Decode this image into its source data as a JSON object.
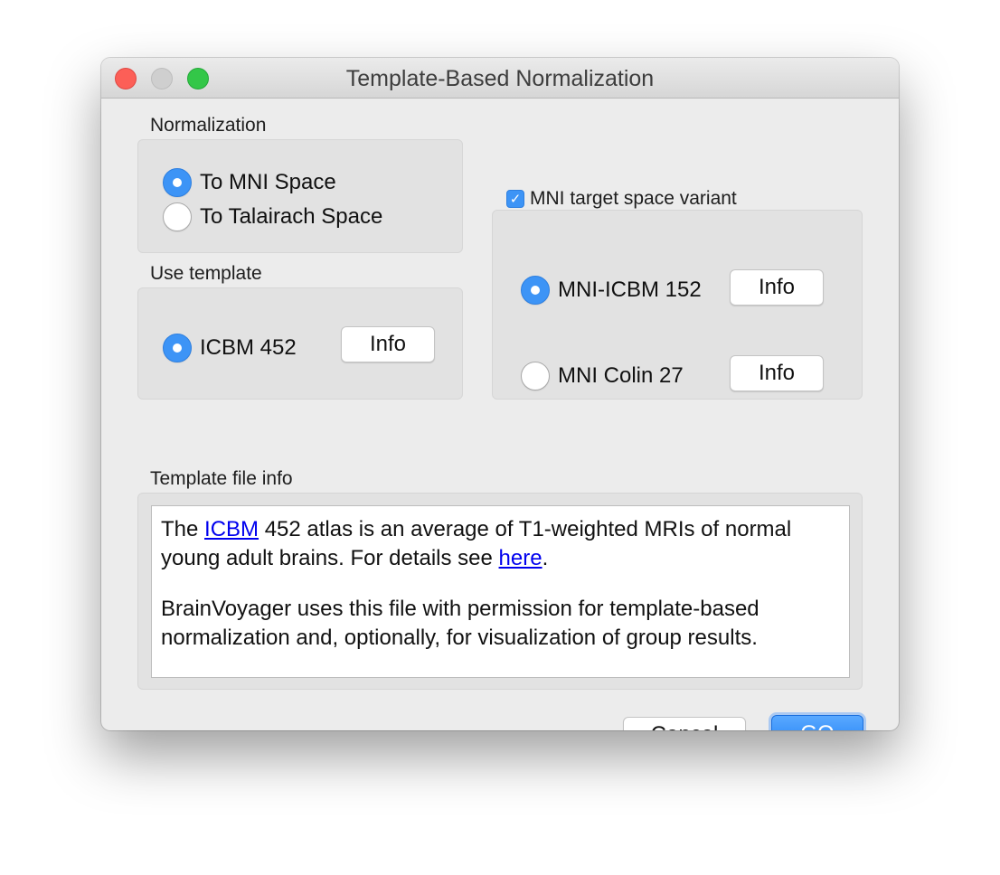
{
  "window": {
    "title": "Template-Based Normalization"
  },
  "normalization": {
    "label": "Normalization",
    "options": [
      {
        "label": "To MNI Space",
        "selected": true
      },
      {
        "label": "To Talairach Space",
        "selected": false
      }
    ]
  },
  "use_template": {
    "label": "Use template",
    "option": {
      "label": "ICBM 452",
      "selected": true
    },
    "info_label": "Info"
  },
  "mni_variant": {
    "checkbox_label": "MNI target space variant",
    "checked": true,
    "options": [
      {
        "label": "MNI-ICBM 152",
        "selected": true,
        "info_label": "Info"
      },
      {
        "label": "MNI Colin 27",
        "selected": false,
        "info_label": "Info"
      }
    ]
  },
  "file_info": {
    "label": "Template file info",
    "p1_before": "The ",
    "p1_link1": "ICBM",
    "p1_middle": " 452 atlas is an average of T1-weighted MRIs of normal young adult brains. For details see ",
    "p1_link2": "here",
    "p1_end": ".",
    "p2": "BrainVoyager uses this file with permission for template-based normalization and, optionally, for visualization of group results."
  },
  "buttons": {
    "cancel": "Cancel",
    "go": "GO"
  },
  "colors": {
    "accent": "#3d94f6",
    "link": "#0000ee"
  }
}
